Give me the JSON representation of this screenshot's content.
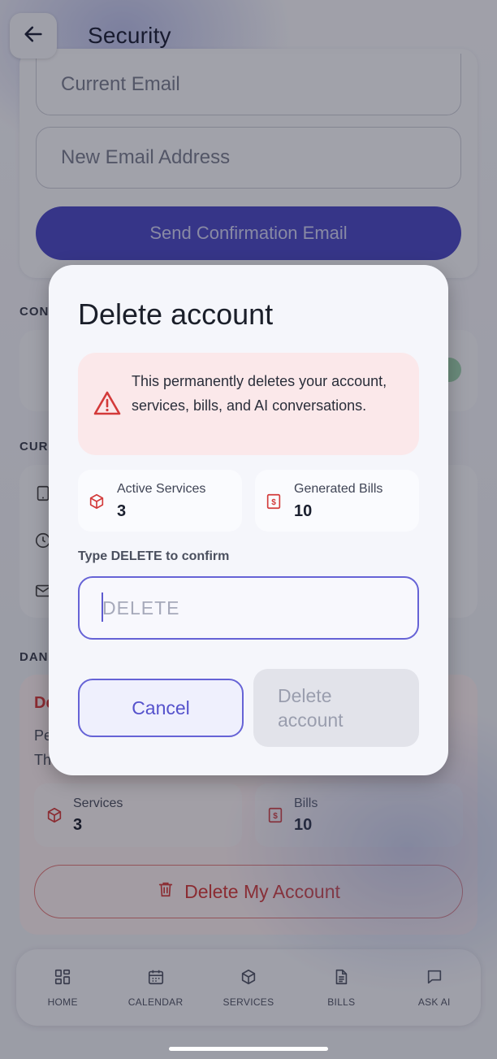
{
  "header": {
    "title": "Security",
    "back_icon": "arrow-left-icon"
  },
  "email_section": {
    "current_email_placeholder": "Current Email",
    "new_email_placeholder": "New Email Address",
    "send_button": "Send Confirmation Email"
  },
  "sections": {
    "connected_label": "CON",
    "current_label": "CUR",
    "danger_label": "DAN"
  },
  "danger_zone": {
    "title": "De",
    "text_line1": "Pe",
    "text_line2": "Th",
    "services_label": "Services",
    "services_value": "3",
    "bills_label": "Bills",
    "bills_value": "10",
    "delete_button": "Delete My Account"
  },
  "modal": {
    "title": "Delete account",
    "warning": "This permanently deletes your account, services, bills, and AI conversations.",
    "active_services_label": "Active Services",
    "active_services_value": "3",
    "generated_bills_label": "Generated Bills",
    "generated_bills_value": "10",
    "confirm_label": "Type DELETE to confirm",
    "confirm_placeholder": "DELETE",
    "cancel_button": "Cancel",
    "delete_button": "Delete account"
  },
  "nav": [
    {
      "label": "HOME",
      "icon": "home-grid-icon"
    },
    {
      "label": "CALENDAR",
      "icon": "calendar-icon"
    },
    {
      "label": "SERVICES",
      "icon": "box-icon"
    },
    {
      "label": "BILLS",
      "icon": "document-icon"
    },
    {
      "label": "ASK AI",
      "icon": "chat-icon"
    }
  ],
  "colors": {
    "accent": "#5552CC",
    "danger": "#D33A3A",
    "warning_bg": "#FBE8EA"
  }
}
